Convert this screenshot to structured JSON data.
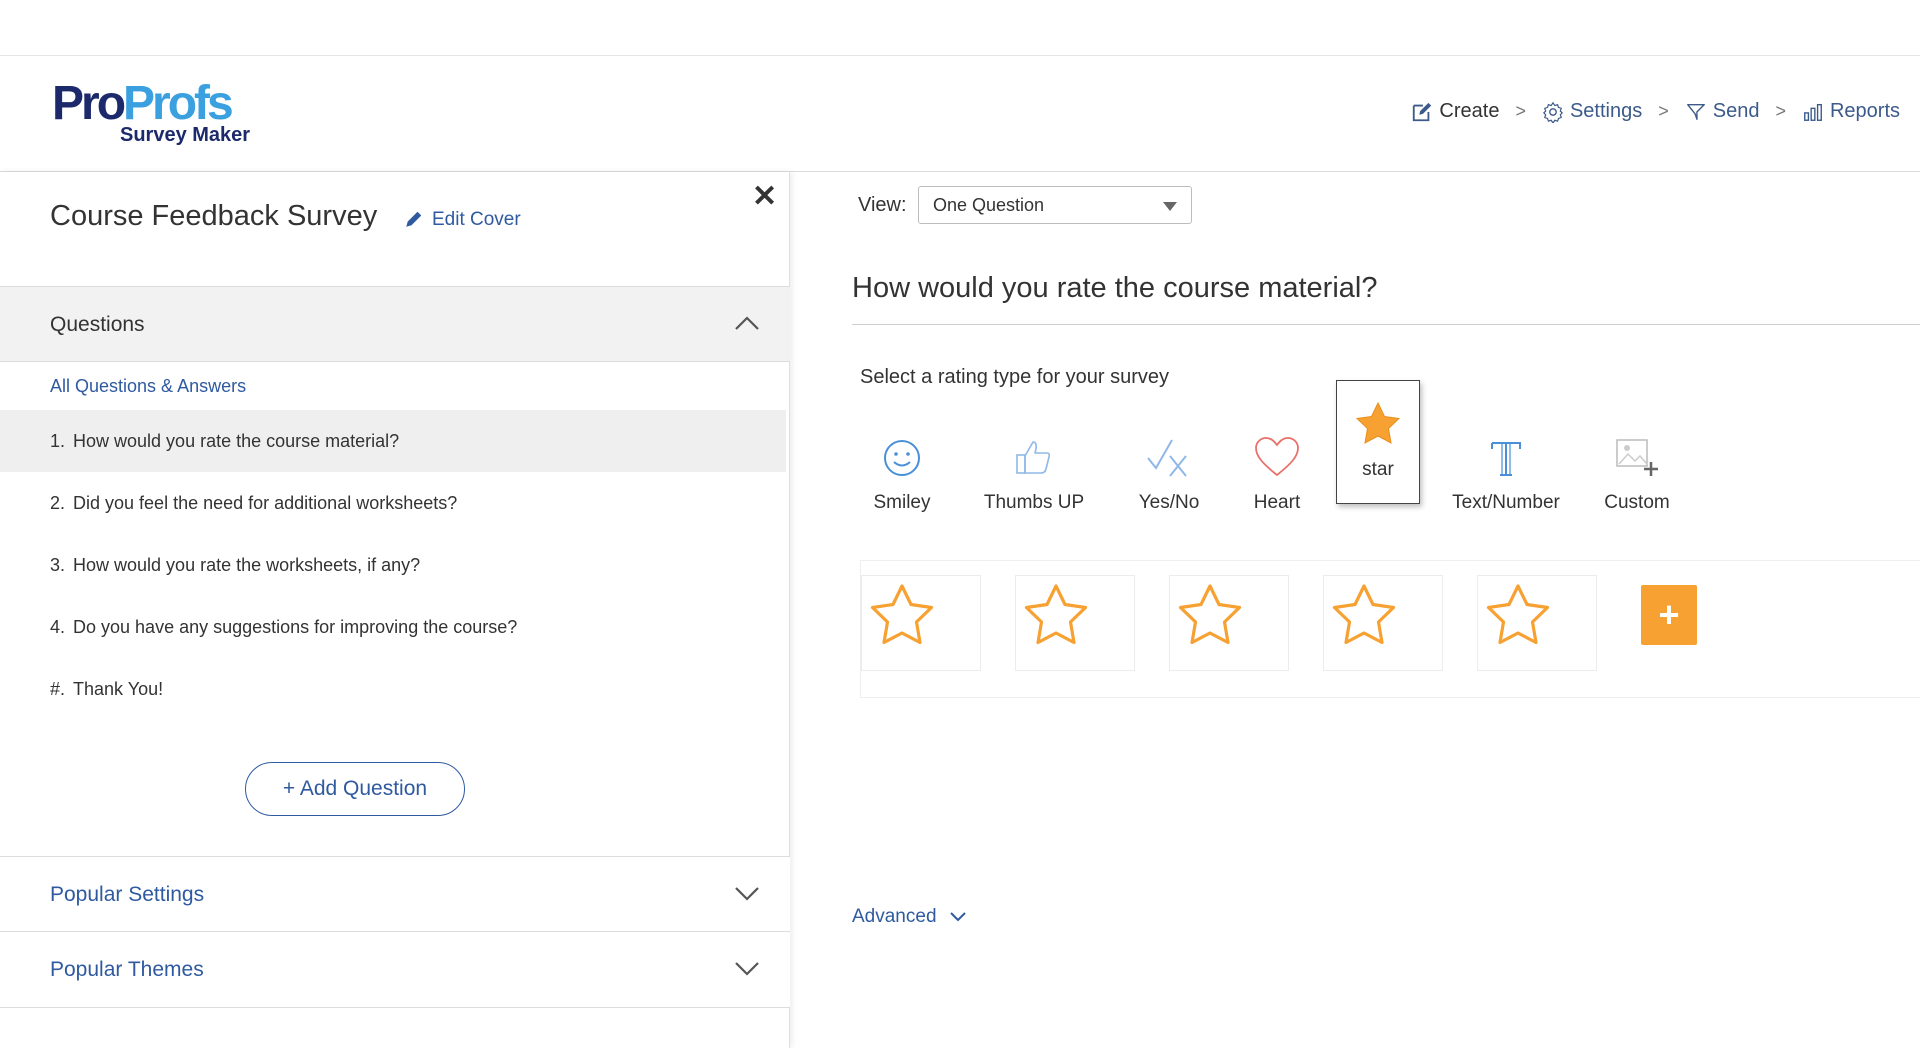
{
  "brand": {
    "logo_part1": "Pro",
    "logo_part2": "Profs",
    "logo_sub": "Survey Maker"
  },
  "nav": {
    "create": "Create",
    "settings": "Settings",
    "send": "Send",
    "reports": "Reports",
    "separator": ">"
  },
  "sidebar": {
    "survey_title": "Course Feedback Survey",
    "edit_cover": "Edit Cover",
    "close": "✕",
    "questions_header": "Questions",
    "all_qa": "All Questions & Answers",
    "questions": [
      {
        "num": "1.",
        "text": "How would you rate the course material?"
      },
      {
        "num": "2.",
        "text": "Did you feel the need for additional worksheets?"
      },
      {
        "num": "3.",
        "text": "How would you rate the worksheets, if any?"
      },
      {
        "num": "4.",
        "text": "Do you have any suggestions for improving the course?"
      },
      {
        "num": "#.",
        "text": "Thank You!"
      }
    ],
    "add_question": "+ Add Question",
    "popular_settings": "Popular Settings",
    "popular_themes": "Popular Themes"
  },
  "main": {
    "view_label": "View:",
    "view_value": "One Question",
    "question_title": "How would you rate the course material?",
    "rating_prompt": "Select a rating type for your survey",
    "rating_types": [
      {
        "label": "Smiley",
        "icon": "smiley-icon"
      },
      {
        "label": "Thumbs UP",
        "icon": "thumbs-up-icon"
      },
      {
        "label": "Yes/No",
        "icon": "yes-no-icon"
      },
      {
        "label": "Heart",
        "icon": "heart-icon"
      },
      {
        "label": "star",
        "icon": "star-icon"
      },
      {
        "label": "Text/Number",
        "icon": "text-number-icon"
      },
      {
        "label": "Custom",
        "icon": "custom-image-icon"
      }
    ],
    "selected_rating_type": "star",
    "star_count": 5,
    "add_star": "+",
    "advanced": "Advanced"
  },
  "colors": {
    "accent_blue": "#2f5aa0",
    "star_orange": "#f6a131",
    "heart_red": "#e8716a",
    "icon_blue": "#4a90d9"
  }
}
